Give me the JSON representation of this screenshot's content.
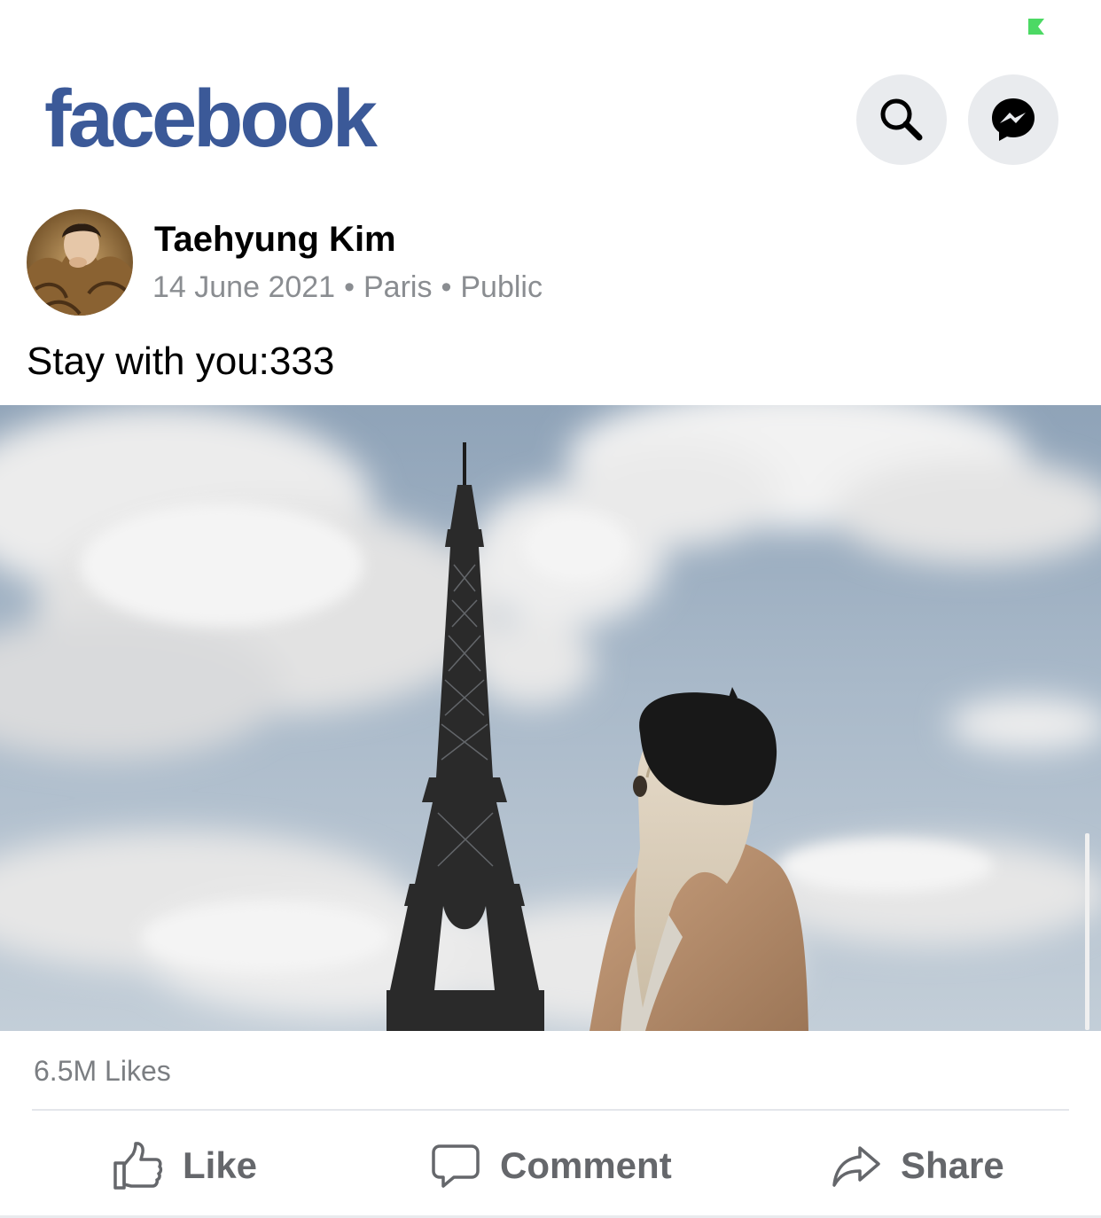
{
  "app": {
    "logo_text": "facebook",
    "brand_color": "#3b5998"
  },
  "header": {
    "search_icon": "search-icon",
    "messenger_icon": "messenger-icon"
  },
  "post": {
    "author": "Taehyung Kim",
    "date": "14 June 2021",
    "location": "Paris",
    "audience": "Public",
    "separator": "•",
    "text": "Stay with you:333",
    "photo": "eiffel-tower-photo",
    "likes": "6.5M Likes"
  },
  "actions": {
    "like": {
      "label": "Like",
      "icon": "thumbs-up-icon"
    },
    "comment": {
      "label": "Comment",
      "icon": "comment-icon"
    },
    "share": {
      "label": "Share",
      "icon": "share-icon"
    }
  },
  "colors": {
    "secondary_text": "#8a8d91",
    "action_text": "#65676b",
    "icon_button_bg": "#e9ebee",
    "status_green": "#4cd964"
  }
}
